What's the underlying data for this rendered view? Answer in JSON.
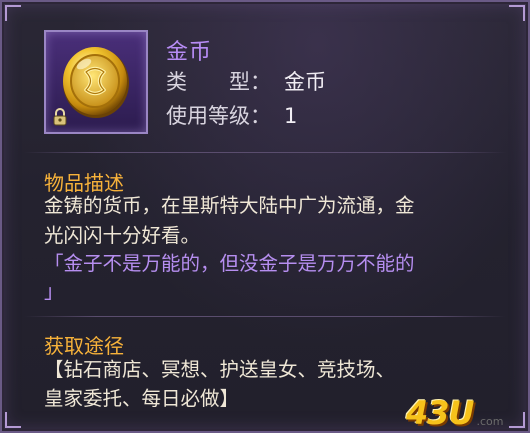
{
  "item": {
    "name": "金币",
    "type_label": "类　　型：",
    "type_value": "金币",
    "level_label": "使用等级：",
    "level_value": "1",
    "icon": "gold-coin-icon",
    "lock_icon": "lock-icon"
  },
  "description": {
    "title": "物品描述",
    "line1": "金铸的货币，在里斯特大陆中广为流通，金",
    "line2": "光闪闪十分好看。",
    "quote_line1": "「金子不是万能的，但没金子是万万不能的",
    "quote_line2": "」"
  },
  "obtain": {
    "title": "获取途径",
    "line1": "【钻石商店、冥想、护送皇女、竞技场、",
    "line2": "皇家委托、每日必做】"
  },
  "watermark": {
    "text": "43U",
    "suffix": ".com"
  },
  "colors": {
    "item_name": "#b78cf5",
    "section_title": "#f7b23a",
    "quote": "#b68ef0",
    "body": "#efe7d6"
  }
}
